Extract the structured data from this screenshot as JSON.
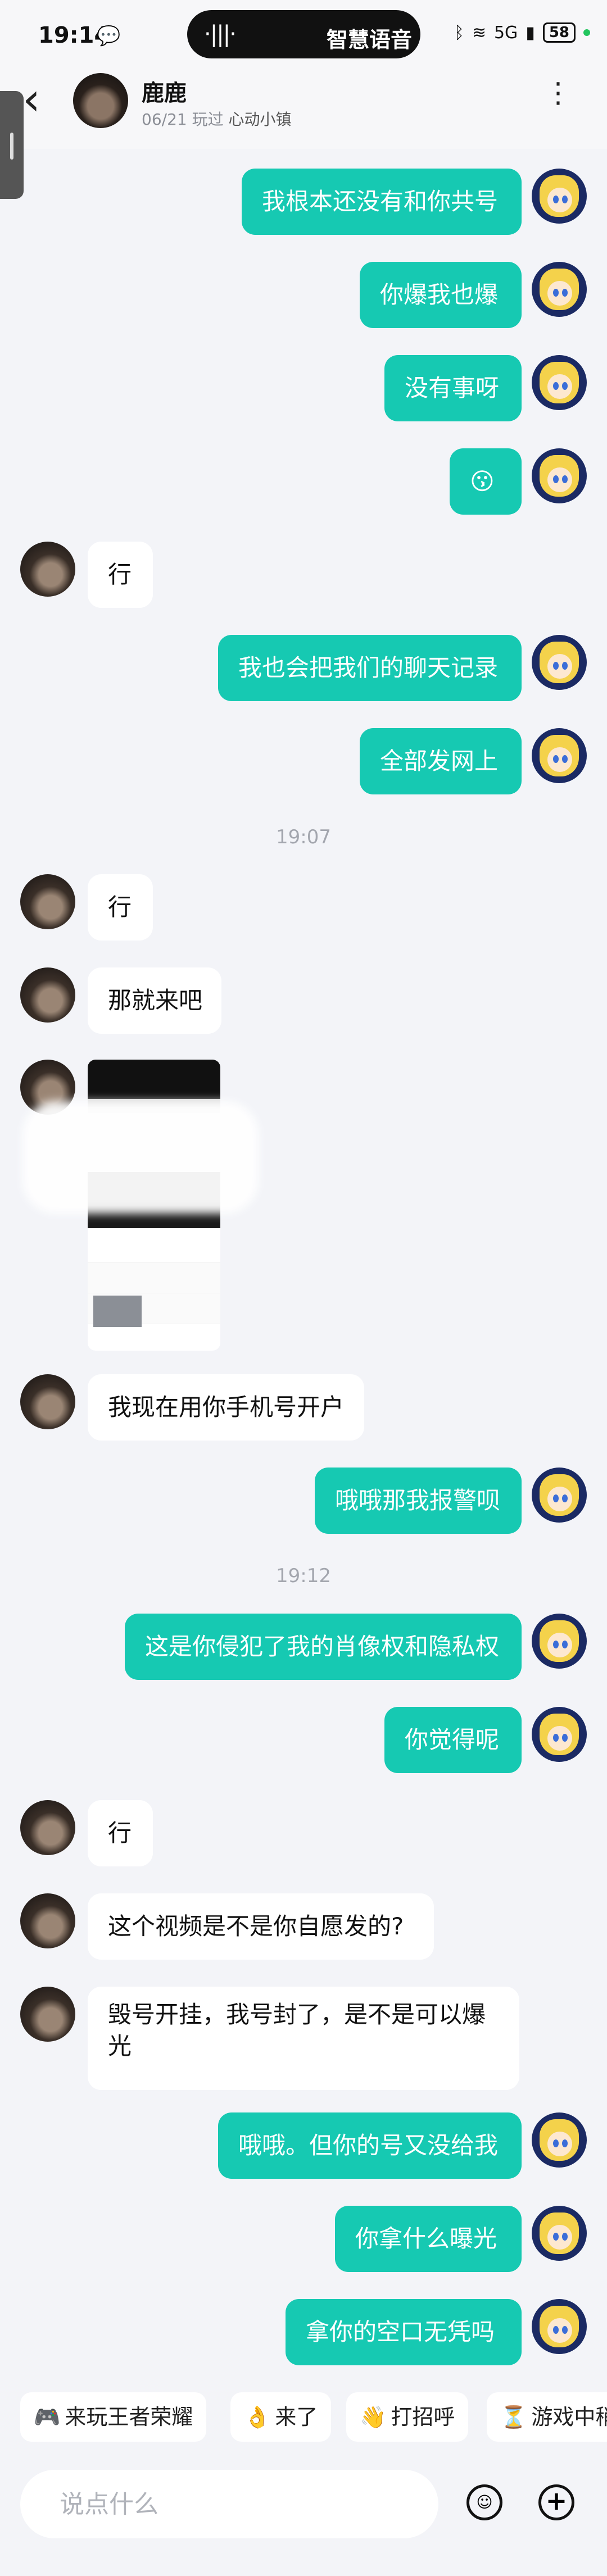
{
  "status_bar": {
    "time": "19:14",
    "wechat_icon": "💬",
    "voice_wave": "·|||·",
    "voice_label": "智慧语音",
    "network": "5G",
    "battery": "58"
  },
  "header": {
    "back_glyph": "‹",
    "name": "鹿鹿",
    "date": "06/21 玩过",
    "game": "心动小镇",
    "more_glyph": "⋮"
  },
  "messages": [
    {
      "side": "right",
      "text": "我根本还没有和你共号"
    },
    {
      "side": "right",
      "text": "你爆我也爆"
    },
    {
      "side": "right",
      "text": "没有事呀"
    },
    {
      "side": "right",
      "text": "😗"
    },
    {
      "side": "left",
      "text": "行"
    },
    {
      "side": "right",
      "text": "我也会把我们的聊天记录"
    },
    {
      "side": "right",
      "text": "全部发网上"
    },
    {
      "type": "time",
      "text": "19:07"
    },
    {
      "side": "left",
      "text": "行"
    },
    {
      "side": "left",
      "text": "那就来吧"
    },
    {
      "side": "left",
      "type": "image"
    },
    {
      "side": "left",
      "text": "我现在用你手机号开户"
    },
    {
      "side": "right",
      "text": "哦哦那我报警呗"
    },
    {
      "type": "time",
      "text": "19:12"
    },
    {
      "side": "right",
      "text": "这是你侵犯了我的肖像权和隐私权"
    },
    {
      "side": "right",
      "text": "你觉得呢"
    },
    {
      "side": "left",
      "text": "行"
    },
    {
      "side": "left",
      "text": "这个视频是不是你自愿发的?"
    },
    {
      "side": "left",
      "text": "毁号开挂，我号封了，是不是可以爆光"
    },
    {
      "side": "right",
      "text": "哦哦。但你的号又没给我"
    },
    {
      "side": "right",
      "text": "你拿什么曝光"
    },
    {
      "side": "right",
      "text": "拿你的空口无凭吗"
    }
  ],
  "quick_replies": [
    {
      "icon": "🎮",
      "label": "来玩王者荣耀"
    },
    {
      "icon": "👌",
      "label": "来了"
    },
    {
      "icon": "👋",
      "label": "打招呼"
    },
    {
      "icon": "⏳",
      "label": "游戏中稍"
    }
  ],
  "input": {
    "placeholder": "说点什么",
    "emoji_glyph": "☺",
    "plus_glyph": "+"
  },
  "colors": {
    "accent": "#16c9b2",
    "background": "#f3f4f8"
  }
}
